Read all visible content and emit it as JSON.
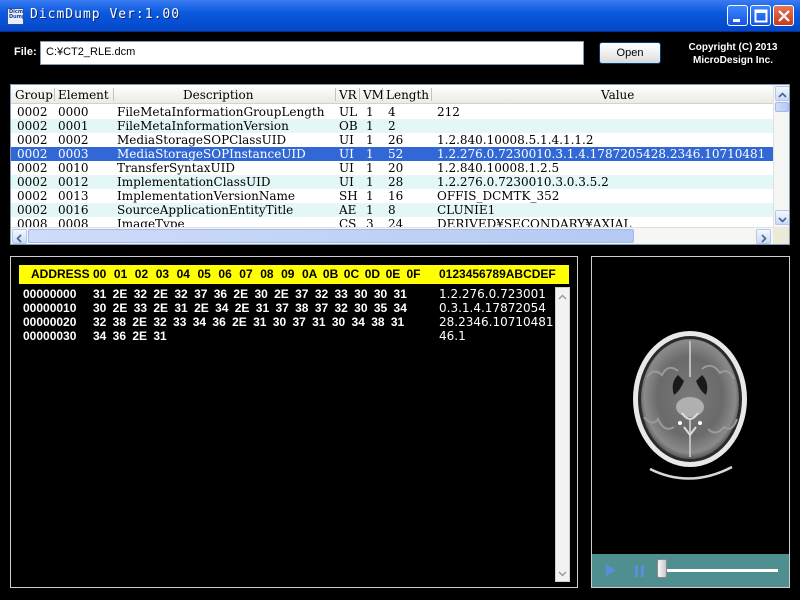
{
  "window": {
    "title": "DicmDump Ver:1.00",
    "app_icon_text": "Dicm Dump",
    "controls": [
      "minimize",
      "maximize",
      "close"
    ]
  },
  "filebar": {
    "label": "File:",
    "file_value": "C:¥CT2_RLE.dcm",
    "open_button": "Open",
    "copyright_line1": "Copyright (C) 2013",
    "copyright_line2": "MicroDesign Inc."
  },
  "table": {
    "headers": [
      "Group",
      "Element",
      "Description",
      "VR",
      "VM",
      "Length",
      "Value"
    ],
    "rows": [
      {
        "group": "0002",
        "element": "0000",
        "description": "FileMetaInformationGroupLength",
        "vr": "UL",
        "vm": "1",
        "length": "4",
        "value": "212"
      },
      {
        "group": "0002",
        "element": "0001",
        "description": "FileMetaInformationVersion",
        "vr": "OB",
        "vm": "1",
        "length": "2",
        "value": ""
      },
      {
        "group": "0002",
        "element": "0002",
        "description": "MediaStorageSOPClassUID",
        "vr": "UI",
        "vm": "1",
        "length": "26",
        "value": "1.2.840.10008.5.1.4.1.1.2"
      },
      {
        "group": "0002",
        "element": "0003",
        "description": "MediaStorageSOPInstanceUID",
        "vr": "UI",
        "vm": "1",
        "length": "52",
        "value": "1.2.276.0.7230010.3.1.4.1787205428.2346.10710481"
      },
      {
        "group": "0002",
        "element": "0010",
        "description": "TransferSyntaxUID",
        "vr": "UI",
        "vm": "1",
        "length": "20",
        "value": "1.2.840.10008.1.2.5"
      },
      {
        "group": "0002",
        "element": "0012",
        "description": "ImplementationClassUID",
        "vr": "UI",
        "vm": "1",
        "length": "28",
        "value": "1.2.276.0.7230010.3.0.3.5.2"
      },
      {
        "group": "0002",
        "element": "0013",
        "description": "ImplementationVersionName",
        "vr": "SH",
        "vm": "1",
        "length": "16",
        "value": "OFFIS_DCMTK_352"
      },
      {
        "group": "0002",
        "element": "0016",
        "description": "SourceApplicationEntityTitle",
        "vr": "AE",
        "vm": "1",
        "length": "8",
        "value": "CLUNIE1"
      },
      {
        "group": "0008",
        "element": "0008",
        "description": "ImageType",
        "vr": "CS",
        "vm": "3",
        "length": "24",
        "value": "DERIVED¥SECONDARY¥AXIAL"
      }
    ],
    "selected_index": 3
  },
  "hexdump": {
    "header_address": "ADDRESS",
    "header_bytes": [
      "00",
      "01",
      "02",
      "03",
      "04",
      "05",
      "06",
      "07",
      "08",
      "09",
      "0A",
      "0B",
      "0C",
      "0D",
      "0E",
      "0F"
    ],
    "header_ascii": "0123456789ABCDEF",
    "rows": [
      {
        "address": "00000000",
        "bytes": "31 2E 32 2E 32 37 36 2E 30 2E 37 32 33 30 30 31",
        "ascii": "1.2.276.0.723001"
      },
      {
        "address": "00000010",
        "bytes": "30 2E 33 2E 31 2E 34 2E 31 37 38 37 32 30 35 34",
        "ascii": "0.3.1.4.17872054"
      },
      {
        "address": "00000020",
        "bytes": "32 38 2E 32 33 34 36 2E 31 30 37 31 30 34 38 31",
        "ascii": "28.2346.10710481"
      },
      {
        "address": "00000030",
        "bytes": "34 36 2E 31",
        "ascii": "46.1"
      }
    ]
  },
  "viewer": {
    "play_icon": "play-icon",
    "pause_icon": "pause-icon",
    "slider_position": 0.0
  },
  "colors": {
    "titlebar": "#0b5ae0",
    "selected_row": "#3168d5",
    "alt_row": "#e3f7f7",
    "hex_header": "#ffff00",
    "player_bar": "#4f8f8f"
  }
}
